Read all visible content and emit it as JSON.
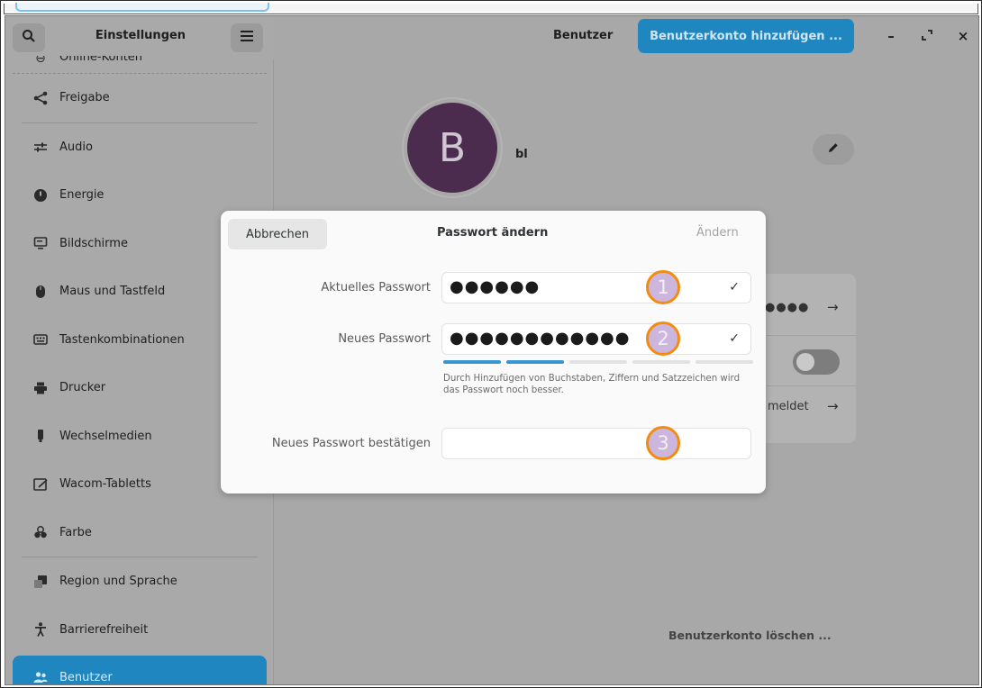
{
  "sidebar": {
    "title": "Einstellungen",
    "search_icon": "search-icon",
    "menu_icon": "hamburger-menu-icon",
    "items": [
      {
        "label": "Online-Konten",
        "icon": "online-accounts-icon"
      },
      {
        "label": "Freigabe",
        "icon": "share-icon"
      },
      {
        "label": "Audio",
        "icon": "audio-sliders-icon"
      },
      {
        "label": "Energie",
        "icon": "power-icon"
      },
      {
        "label": "Bildschirme",
        "icon": "display-icon"
      },
      {
        "label": "Maus und Tastfeld",
        "icon": "mouse-icon"
      },
      {
        "label": "Tastenkombinationen",
        "icon": "keyboard-icon"
      },
      {
        "label": "Drucker",
        "icon": "printer-icon"
      },
      {
        "label": "Wechselmedien",
        "icon": "removable-media-icon"
      },
      {
        "label": "Wacom-Tabletts",
        "icon": "tablet-icon"
      },
      {
        "label": "Farbe",
        "icon": "color-icon"
      },
      {
        "label": "Region und Sprache",
        "icon": "region-icon"
      },
      {
        "label": "Barrierefreiheit",
        "icon": "accessibility-icon"
      },
      {
        "label": "Benutzer",
        "icon": "users-icon"
      }
    ]
  },
  "header": {
    "title": "Benutzer",
    "add_account": "Benutzerkonto hinzufügen ...",
    "minimize": "–",
    "maximize": "⤢",
    "close": "×"
  },
  "user": {
    "avatar_letter": "B",
    "name": "bl",
    "password_fragment": "●●●●",
    "arrow": "→",
    "login_fragment": "meldet",
    "delete_account": "Benutzerkonto löschen ..."
  },
  "dialog": {
    "cancel": "Abbrechen",
    "title": "Passwort ändern",
    "confirm": "Ändern",
    "current_label": "Aktuelles Passwort",
    "current_value": "●●●●●●",
    "new_label": "Neues Passwort",
    "new_value": "●●●●●●●●●●●●",
    "confirm_label": "Neues Passwort bestätigen",
    "confirm_value": "",
    "check": "✓",
    "strength_filled": 2,
    "strength_total": 5,
    "hint": "Durch Hinzufügen von Buchstaben, Ziffern und Satzzeichen wird das Passwort noch besser.",
    "badges": [
      "1",
      "2",
      "3"
    ]
  },
  "colors": {
    "accent": "#1f86bf",
    "badge_border": "#f28c10",
    "badge_fill": "#cdb6de",
    "avatar": "#4b2b4e"
  }
}
